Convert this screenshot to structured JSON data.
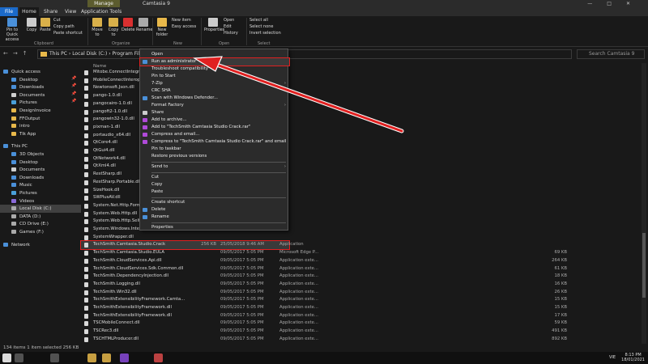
{
  "window": {
    "title": "Camtasia 9",
    "contextual_tab": "Manage",
    "controls": [
      "—",
      "□",
      "✕"
    ]
  },
  "tabs": {
    "file": "File",
    "home": "Home",
    "share": "Share",
    "view": "View",
    "app_tools": "Application Tools"
  },
  "ribbon": {
    "pin_label": "Pin to Quick access",
    "copy_label": "Copy",
    "paste_label": "Paste",
    "cut_label": "Cut",
    "copy_path_label": "Copy path",
    "paste_shortcut_label": "Paste shortcut",
    "clipboard_group": "Clipboard",
    "move_to_label": "Move to",
    "copy_to_label": "Copy to",
    "delete_label": "Delete",
    "rename_label": "Rename",
    "organize_group": "Organize",
    "new_folder_label": "New folder",
    "new_item_label": "New item",
    "easy_access_label": "Easy access",
    "new_group": "New",
    "properties_label": "Properties",
    "open_label": "Open",
    "edit_label": "Edit",
    "history_label": "History",
    "open_group": "Open",
    "select_all_label": "Select all",
    "select_none_label": "Select none",
    "invert_selection_label": "Invert selection",
    "select_group": "Select"
  },
  "address": {
    "path": "This PC  ›  Local Disk (C:)  ›  Program Files  ›  Te",
    "search_placeholder": "Search Camtasia 9"
  },
  "sidebar": {
    "items": [
      {
        "label": "Quick access",
        "color": "#4a90d9",
        "pinned": false
      },
      {
        "label": "Desktop",
        "color": "#4a90d9",
        "pinned": true
      },
      {
        "label": "Downloads",
        "color": "#4a90d9",
        "pinned": true
      },
      {
        "label": "Documents",
        "color": "#cfcfcf",
        "pinned": true
      },
      {
        "label": "Pictures",
        "color": "#4aa0d9",
        "pinned": true
      },
      {
        "label": "DesignInvoice",
        "color": "#e8b84a",
        "pinned": false
      },
      {
        "label": "FFOutput",
        "color": "#e8b84a",
        "pinned": false
      },
      {
        "label": "intro",
        "color": "#e8b84a",
        "pinned": false
      },
      {
        "label": "Tik App",
        "color": "#e8b84a",
        "pinned": false
      },
      {
        "label": "This PC",
        "color": "#4a90d9",
        "pinned": false
      },
      {
        "label": "3D Objects",
        "color": "#4a90d9",
        "pinned": false
      },
      {
        "label": "Desktop",
        "color": "#4a90d9",
        "pinned": false
      },
      {
        "label": "Documents",
        "color": "#cfcfcf",
        "pinned": false
      },
      {
        "label": "Downloads",
        "color": "#4a90d9",
        "pinned": false
      },
      {
        "label": "Music",
        "color": "#4a90d9",
        "pinned": false
      },
      {
        "label": "Pictures",
        "color": "#4aa0d9",
        "pinned": false
      },
      {
        "label": "Videos",
        "color": "#8a6ad9",
        "pinned": false
      },
      {
        "label": "Local Disk (C:)",
        "color": "#aaaaaa",
        "pinned": false
      },
      {
        "label": "DATA (D:)",
        "color": "#aaaaaa",
        "pinned": false
      },
      {
        "label": "CD Drive (E:)",
        "color": "#aaaaaa",
        "pinned": false
      },
      {
        "label": "Games (F:)",
        "color": "#aaaaaa",
        "pinned": false
      },
      {
        "label": "Network",
        "color": "#4a90d9",
        "pinned": false
      }
    ],
    "pin_glyph": "📌"
  },
  "files": {
    "column_name": "Name",
    "rows": [
      {
        "name": "Mitobe.ConnectIntegration",
        "date": "",
        "type": "",
        "size": ""
      },
      {
        "name": "MobileConnectInterop.dll",
        "date": "",
        "type": "",
        "size": ""
      },
      {
        "name": "Newtonsoft.Json.dll",
        "date": "",
        "type": "",
        "size": ""
      },
      {
        "name": "pango-1.0.dll",
        "date": "",
        "type": "",
        "size": ""
      },
      {
        "name": "pangocairo-1.0.dll",
        "date": "",
        "type": "",
        "size": ""
      },
      {
        "name": "pangoft2-1.0.dll",
        "date": "",
        "type": "",
        "size": ""
      },
      {
        "name": "pangowin32-1.0.dll",
        "date": "",
        "type": "",
        "size": ""
      },
      {
        "name": "pixman-1.dll",
        "date": "",
        "type": "",
        "size": ""
      },
      {
        "name": "portaudio_x64.dll",
        "date": "",
        "type": "",
        "size": ""
      },
      {
        "name": "QtCore4.dll",
        "date": "",
        "type": "",
        "size": ""
      },
      {
        "name": "QtGui4.dll",
        "date": "",
        "type": "",
        "size": ""
      },
      {
        "name": "QtNetwork4.dll",
        "date": "",
        "type": "",
        "size": ""
      },
      {
        "name": "QtXml4.dll",
        "date": "",
        "type": "",
        "size": ""
      },
      {
        "name": "RestSharp.dll",
        "date": "",
        "type": "",
        "size": ""
      },
      {
        "name": "RestSharp.Portable.dll",
        "date": "",
        "type": "",
        "size": ""
      },
      {
        "name": "SizeHook.dll",
        "date": "",
        "type": "",
        "size": ""
      },
      {
        "name": "SWPlusAV.dll",
        "date": "",
        "type": "",
        "size": ""
      },
      {
        "name": "System.Net.Http.Formatti",
        "date": "",
        "type": "",
        "size": ""
      },
      {
        "name": "System.Web.Http.dll",
        "date": "",
        "type": "",
        "size": ""
      },
      {
        "name": "System.Web.Http.SelfHos",
        "date": "",
        "type": "",
        "size": ""
      },
      {
        "name": "System.Windows.Interacti",
        "date": "",
        "type": "",
        "size": ""
      },
      {
        "name": "SystemWrapper.dll",
        "date": "",
        "type": "",
        "size": ""
      },
      {
        "name": "TechSmith.Camtasia.Studio.Crack",
        "date": "25/05/2018 9:46 AM",
        "type": "Application",
        "size": "256 KB"
      },
      {
        "name": "TechSmith.Camtasia.Studio.EULA",
        "date": "09/05/2017 5:05 PM",
        "type": "Microsoft Edge P...",
        "size": "69 KB"
      },
      {
        "name": "TechSmith.CloudServices.Api.dll",
        "date": "09/05/2017 5:05 PM",
        "type": "Application exte...",
        "size": "264 KB"
      },
      {
        "name": "TechSmith.CloudServices.Sdk.Common.dll",
        "date": "09/05/2017 5:05 PM",
        "type": "Application exte...",
        "size": "61 KB"
      },
      {
        "name": "TechSmith.DependencyInjection.dll",
        "date": "09/05/2017 5:05 PM",
        "type": "Application exte...",
        "size": "18 KB"
      },
      {
        "name": "TechSmith.Logging.dll",
        "date": "09/05/2017 5:05 PM",
        "type": "Application exte...",
        "size": "16 KB"
      },
      {
        "name": "TechSmith.Win32.dll",
        "date": "09/05/2017 5:05 PM",
        "type": "Application exte...",
        "size": "26 KB"
      },
      {
        "name": "TechSmithExtensibilityFramework.Camta...",
        "date": "09/05/2017 5:05 PM",
        "type": "Application exte...",
        "size": "15 KB"
      },
      {
        "name": "TechSmithExtensibilityFramework.dll",
        "date": "09/05/2017 5:05 PM",
        "type": "Application exte...",
        "size": "15 KB"
      },
      {
        "name": "TechSmithExtensibilityFramework.dll",
        "date": "09/05/2017 5:05 PM",
        "type": "Application exte...",
        "size": "17 KB"
      },
      {
        "name": "TSCMobileConnect.dll",
        "date": "09/05/2017 5:05 PM",
        "type": "Application exte...",
        "size": "59 KB"
      },
      {
        "name": "TSCRec3.dll",
        "date": "09/05/2017 5:05 PM",
        "type": "Application exte...",
        "size": "491 KB"
      },
      {
        "name": "TSCHTMLProducer.dll",
        "date": "09/05/2017 5:05 PM",
        "type": "Application exte...",
        "size": "892 KB"
      },
      {
        "name": "Trackerbird.dll",
        "date": "24/10/2016 10:16 AM",
        "type": "Application exte...",
        "size": "1,249 KB"
      },
      {
        "name": "TREC.dll",
        "date": "09/05/2017 5:05 PM",
        "type": "Application exte...",
        "size": "18 KB"
      },
      {
        "name": "VimeoInterop.dll",
        "date": "09/05/2017 5:05 PM",
        "type": "Application exte...",
        "size": "26 KB"
      }
    ]
  },
  "context_menu": {
    "items": [
      {
        "label": "Open",
        "icon": "",
        "sub": false,
        "sep_before": false
      },
      {
        "label": "Run as administrator",
        "icon": "shield-icon",
        "sub": false,
        "sep_before": false
      },
      {
        "label": "Troubleshoot compatibility",
        "icon": "",
        "sub": false,
        "sep_before": false
      },
      {
        "label": "Pin to Start",
        "icon": "",
        "sub": false,
        "sep_before": false
      },
      {
        "label": "7-Zip",
        "icon": "",
        "sub": true,
        "sep_before": false
      },
      {
        "label": "CRC SHA",
        "icon": "",
        "sub": true,
        "sep_before": false
      },
      {
        "label": "Scan with Windows Defender...",
        "icon": "defender-icon",
        "sub": false,
        "sep_before": false
      },
      {
        "label": "Format Factory",
        "icon": "",
        "sub": true,
        "sep_before": false
      },
      {
        "label": "Share",
        "icon": "share-icon",
        "sub": false,
        "sep_before": false
      },
      {
        "label": "Add to archive...",
        "icon": "archive-icon",
        "sub": false,
        "sep_before": false
      },
      {
        "label": "Add to \"TechSmith Camtasia Studio Crack.rar\"",
        "icon": "archive-icon",
        "sub": false,
        "sep_before": false
      },
      {
        "label": "Compress and email...",
        "icon": "archive-icon",
        "sub": false,
        "sep_before": false
      },
      {
        "label": "Compress to \"TechSmith Camtasia Studio Crack.rar\" and email",
        "icon": "archive-icon",
        "sub": false,
        "sep_before": false
      },
      {
        "label": "Pin to taskbar",
        "icon": "",
        "sub": false,
        "sep_before": false
      },
      {
        "label": "Restore previous versions",
        "icon": "",
        "sub": false,
        "sep_before": false
      },
      {
        "label": "Send to",
        "icon": "",
        "sub": true,
        "sep_before": true
      },
      {
        "label": "Cut",
        "icon": "",
        "sub": false,
        "sep_before": true
      },
      {
        "label": "Copy",
        "icon": "",
        "sub": false,
        "sep_before": false
      },
      {
        "label": "Paste",
        "icon": "",
        "sub": false,
        "sep_before": false
      },
      {
        "label": "Create shortcut",
        "icon": "",
        "sub": false,
        "sep_before": true
      },
      {
        "label": "Delete",
        "icon": "shield-icon",
        "sub": false,
        "sep_before": false
      },
      {
        "label": "Rename",
        "icon": "shield-icon",
        "sub": false,
        "sep_before": false
      },
      {
        "label": "Properties",
        "icon": "",
        "sub": false,
        "sep_before": true
      }
    ],
    "submenu_glyph": "›"
  },
  "status": {
    "text": "134 items    1 item selected  256 KB"
  },
  "taskbar": {
    "apps": [
      {
        "name": "windows-start-icon",
        "color": "#ffffff"
      },
      {
        "name": "search-icon",
        "color": "#cccccc"
      },
      {
        "name": "task-view-icon",
        "color": "#cccccc"
      },
      {
        "name": "chrome-icon",
        "color": "#e8b84a"
      },
      {
        "name": "file-explorer-icon",
        "color": "#e8b84a"
      },
      {
        "name": "visual-studio-icon",
        "color": "#8a4ad9"
      },
      {
        "name": "app-icon",
        "color": "#d94a4a"
      }
    ],
    "lang": "VIE",
    "time": "8:13 PM",
    "date": "18/01/2021"
  },
  "colors": {
    "accent": "#1b6ac9",
    "highlight_outline": "#e02020",
    "arrow": "#e02020"
  }
}
